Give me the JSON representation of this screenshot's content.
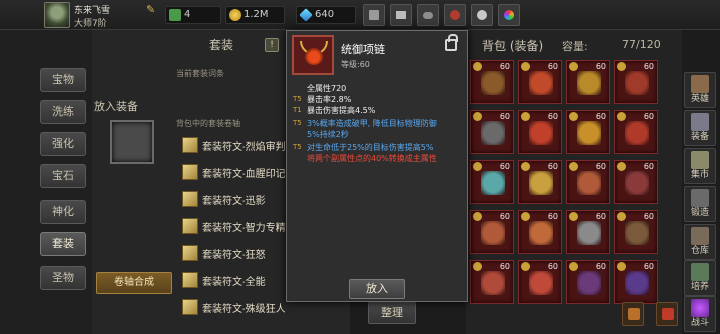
{
  "player": {
    "name": "东来飞雪",
    "rank": "大师7阶"
  },
  "resources": {
    "stamina": "4",
    "gold": "1.2M",
    "gems": "640"
  },
  "left_nav": {
    "items": [
      "宝物",
      "洗练",
      "强化",
      "宝石",
      "神化",
      "套装",
      "圣物"
    ],
    "active": "套装"
  },
  "suit_panel": {
    "title": "套装",
    "help": "!",
    "current_suit_label": "当前套装词条",
    "equip_label": "放入装备",
    "bag_suit_label": "背包中的套装卷轴",
    "scrolls": [
      "套装符文-烈焰审判",
      "套装符文-血腥印记",
      "套装符文-迅影",
      "套装符文-智力专精",
      "套装符文-狂怒",
      "套装符文-全能",
      "套装符文-殊级狂人"
    ],
    "synth_button": "卷轴合成"
  },
  "bag": {
    "title": "背包 (装备)",
    "capacity_label": "容量:",
    "capacity_value": "77/120",
    "arrange_button": "整理",
    "item_level": "60",
    "items": [
      {
        "icon": "helmet-icon",
        "color": "#8a5a2a"
      },
      {
        "icon": "mask-icon",
        "color": "#c04a2a"
      },
      {
        "icon": "armor-icon",
        "color": "#b88a2a"
      },
      {
        "icon": "shoulder-icon",
        "color": "#a03a2a"
      },
      {
        "icon": "helmet-icon",
        "color": "#6a6a6a"
      },
      {
        "icon": "armor-icon",
        "color": "#c0402a"
      },
      {
        "icon": "armor-icon",
        "color": "#c8902a"
      },
      {
        "icon": "armor-icon",
        "color": "#b03a2a"
      },
      {
        "icon": "amulet-icon",
        "color": "#5aa8a8"
      },
      {
        "icon": "amulet-icon",
        "color": "#c8a040"
      },
      {
        "icon": "belt-icon",
        "color": "#b05a3a"
      },
      {
        "icon": "belt-icon",
        "color": "#8a3a3a"
      },
      {
        "icon": "amulet-icon",
        "color": "#b05a3a"
      },
      {
        "icon": "amulet-icon",
        "color": "#c06a3a"
      },
      {
        "icon": "chain-icon",
        "color": "#8a8a8a"
      },
      {
        "icon": "gauntlet-icon",
        "color": "#7a5a3a"
      },
      {
        "icon": "head-icon",
        "color": "#b04a3a"
      },
      {
        "icon": "amulet-icon",
        "color": "#c04a3a"
      },
      {
        "icon": "boots-icon",
        "color": "#6a3a7a"
      },
      {
        "icon": "boots-icon",
        "color": "#5a3a8a"
      }
    ]
  },
  "side_nav": [
    "英雄",
    "装备",
    "集市",
    "锻造",
    "仓库",
    "培养",
    "战斗"
  ],
  "tooltip": {
    "name": "统御项链",
    "level": "等级:60",
    "stats": [
      {
        "tier": "",
        "text": "全属性720",
        "color": "white"
      },
      {
        "tier": "T5",
        "text": "暴击率2.8%",
        "color": "white"
      },
      {
        "tier": "T1",
        "text": "暴击伤害提高4.5%",
        "color": "white"
      },
      {
        "tier": "T5",
        "text": "3%概率造成破甲, 降低目标物理防御",
        "color": "blue"
      },
      {
        "tier": "",
        "text": "5%持续2秒",
        "color": "blue"
      },
      {
        "tier": "T5",
        "text": "对生命低于25%的目标伤害提高5%",
        "color": "blue"
      },
      {
        "tier": "",
        "text": "将两个副属性点的40%转换成主属性",
        "color": "red"
      }
    ],
    "putin_button": "放入"
  },
  "colors": {
    "accent_gold": "#c9a23a",
    "stat_blue": "#5aa8f0",
    "stat_red": "#f04a3a",
    "slot_red": "#4a1414"
  }
}
